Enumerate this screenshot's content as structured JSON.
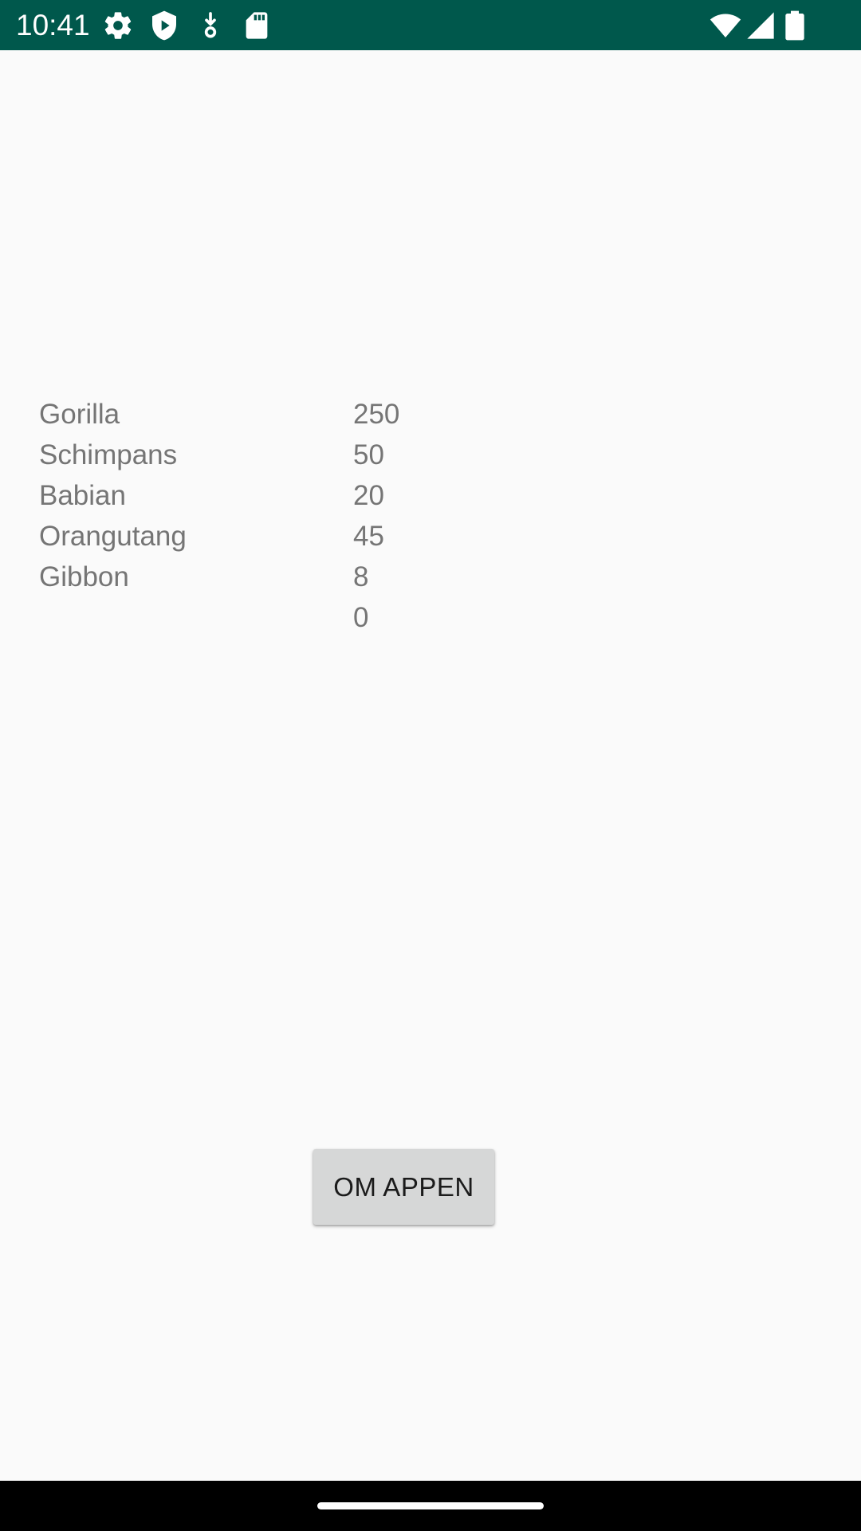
{
  "status_bar": {
    "time": "10:41",
    "background_color": "#00584c",
    "left_icons": [
      "gear-icon",
      "shield-play-icon",
      "download-icon",
      "sd-card-icon"
    ],
    "right_icons": [
      "wifi-icon",
      "cell-signal-icon",
      "battery-icon"
    ]
  },
  "primates": [
    {
      "name": "Gorilla",
      "count": "250"
    },
    {
      "name": "Schimpans",
      "count": "50"
    },
    {
      "name": "Babian",
      "count": "20"
    },
    {
      "name": "Orangutang",
      "count": "45"
    },
    {
      "name": "Gibbon",
      "count": "8"
    },
    {
      "name": "",
      "count": "0"
    }
  ],
  "about_button": {
    "label": "OM APPEN"
  },
  "colors": {
    "background": "#fafafa",
    "text_secondary": "#757575",
    "button_background": "#d6d7d7"
  }
}
